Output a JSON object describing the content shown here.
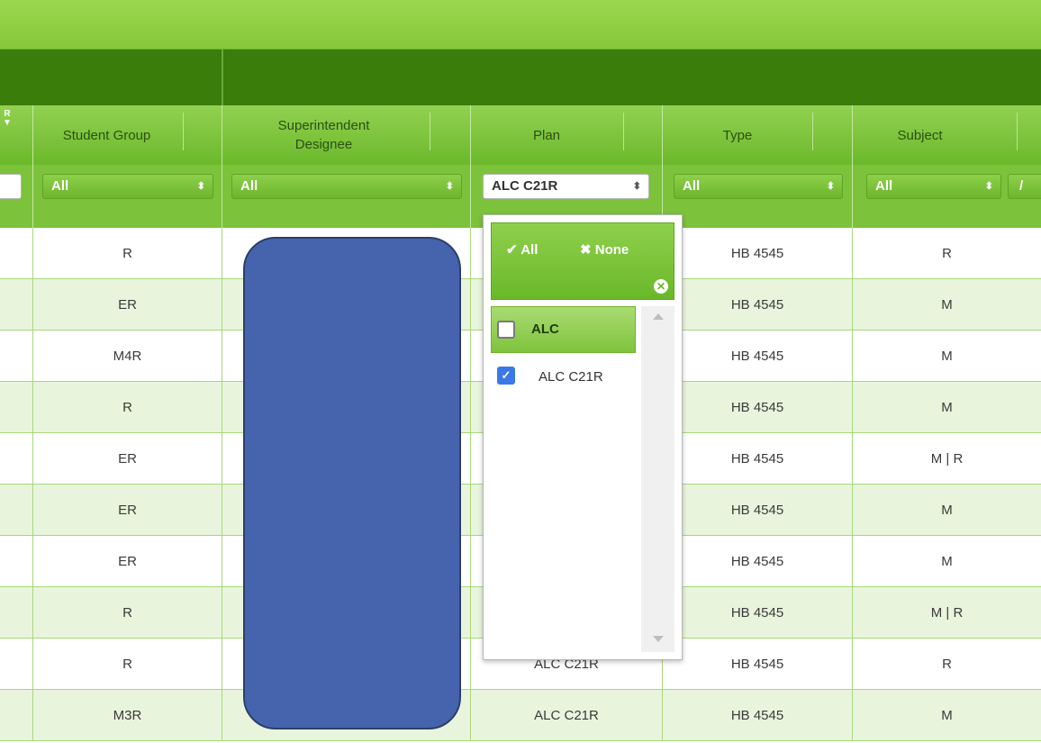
{
  "headers": {
    "sort_mark": "R",
    "student_group": "Student Group",
    "superintendent_designee": "Superintendent Designee",
    "plan": "Plan",
    "type": "Type",
    "subject": "Subject"
  },
  "filters": {
    "student_group": "All",
    "superintendent_designee": "All",
    "plan": "ALC C21R",
    "type": "All",
    "subject": "All",
    "subject_extra": "/"
  },
  "dropdown": {
    "select_all_label": "All",
    "select_none_label": "None",
    "group_label": "ALC",
    "group_checked": false,
    "options": [
      {
        "label": "ALC C21R",
        "checked": true
      }
    ]
  },
  "rows": [
    {
      "student_group": "R",
      "plan": "",
      "type": "HB 4545",
      "subject": "R"
    },
    {
      "student_group": "ER",
      "plan": "",
      "type": "HB 4545",
      "subject": "M"
    },
    {
      "student_group": "M4R",
      "plan": "",
      "type": "HB 4545",
      "subject": "M"
    },
    {
      "student_group": "R",
      "plan": "",
      "type": "HB 4545",
      "subject": "M"
    },
    {
      "student_group": "ER",
      "plan": "",
      "type": "HB 4545",
      "subject": "M | R"
    },
    {
      "student_group": "ER",
      "plan": "",
      "type": "HB 4545",
      "subject": "M"
    },
    {
      "student_group": "ER",
      "plan": "",
      "type": "HB 4545",
      "subject": "M"
    },
    {
      "student_group": "R",
      "plan": "",
      "type": "HB 4545",
      "subject": "M | R"
    },
    {
      "student_group": "R",
      "plan": "ALC C21R",
      "type": "HB 4545",
      "subject": "R"
    },
    {
      "student_group": "M3R",
      "plan": "ALC C21R",
      "type": "HB 4545",
      "subject": "M"
    }
  ],
  "colors": {
    "header_green": "#7cc23a",
    "dark_green": "#3a7d0a",
    "alt_row": "#e8f5dc",
    "redaction": "#4664ad",
    "checkbox_blue": "#3b78e7"
  }
}
